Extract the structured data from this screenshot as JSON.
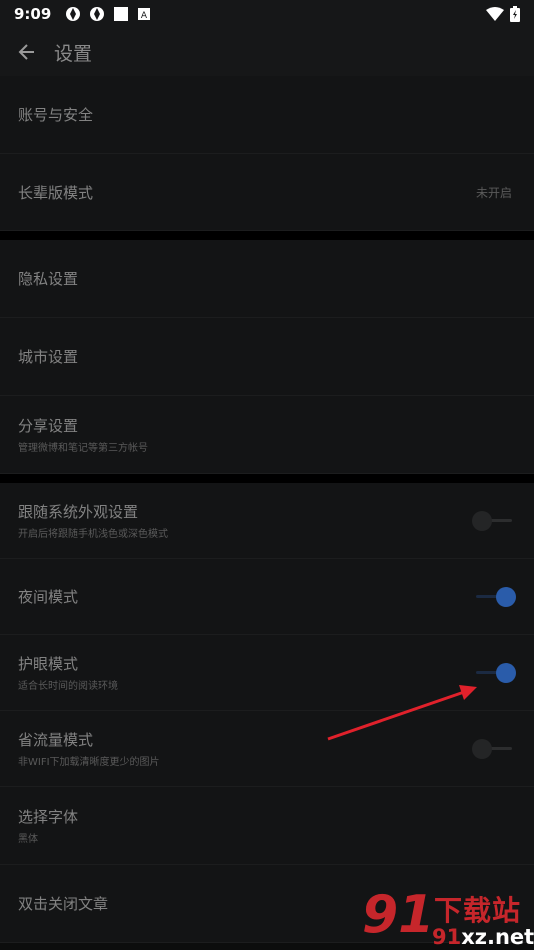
{
  "status_bar": {
    "time": "9:09"
  },
  "toolbar": {
    "title": "设置"
  },
  "rows": {
    "account": {
      "label": "账号与安全"
    },
    "elder": {
      "label": "长辈版模式",
      "value": "未开启"
    },
    "privacy": {
      "label": "隐私设置"
    },
    "city": {
      "label": "城市设置"
    },
    "share": {
      "label": "分享设置",
      "sub": "管理微博和笔记等第三方帐号"
    },
    "follow_system": {
      "label": "跟随系统外观设置",
      "sub": "开启后将跟随手机浅色或深色模式",
      "switch": "off"
    },
    "night": {
      "label": "夜间模式",
      "switch": "on"
    },
    "eye": {
      "label": "护眼模式",
      "sub": "适合长时间的阅读环境",
      "switch": "on"
    },
    "data_saver": {
      "label": "省流量模式",
      "sub": "非WIFI下加载清晰度更少的图片",
      "switch": "off"
    },
    "font": {
      "label": "选择字体",
      "sub": "黑体"
    },
    "double_tap": {
      "label": "双击关闭文章"
    }
  },
  "watermark": {
    "logo": "91",
    "chinese": "下载站",
    "url_prefix": "91",
    "url_rest": "xz.net"
  },
  "colors": {
    "accent_on": "#2a5caa",
    "annotation_arrow": "#e0212b",
    "watermark_red": "#c6262b"
  },
  "icons": [
    "back-arrow-icon",
    "wifi-icon",
    "battery-icon"
  ]
}
